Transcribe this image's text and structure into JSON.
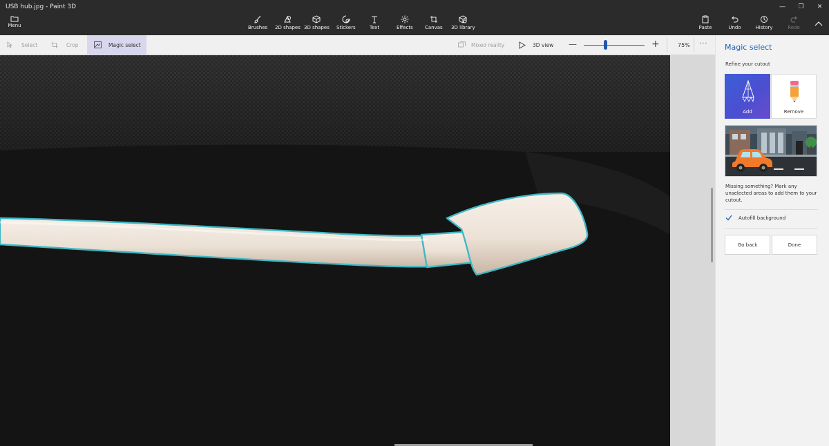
{
  "app": {
    "title": "USB hub.jpg - Paint 3D"
  },
  "window_controls": {
    "minimize": "—",
    "restore": "❐",
    "close": "✕"
  },
  "ribbon": {
    "menu_label": "Menu",
    "tools": [
      {
        "label": "Brushes",
        "icon": "brush-icon"
      },
      {
        "label": "2D shapes",
        "icon": "2d-shapes-icon"
      },
      {
        "label": "3D shapes",
        "icon": "3d-shapes-icon"
      },
      {
        "label": "Stickers",
        "icon": "stickers-icon"
      },
      {
        "label": "Text",
        "icon": "text-icon"
      },
      {
        "label": "Effects",
        "icon": "effects-icon"
      },
      {
        "label": "Canvas",
        "icon": "canvas-icon"
      },
      {
        "label": "3D library",
        "icon": "3d-library-icon"
      }
    ],
    "right_tools": [
      {
        "label": "Paste",
        "icon": "paste-icon",
        "enabled": true
      },
      {
        "label": "Undo",
        "icon": "undo-icon",
        "enabled": true
      },
      {
        "label": "History",
        "icon": "history-icon",
        "enabled": true
      },
      {
        "label": "Redo",
        "icon": "redo-icon",
        "enabled": false
      }
    ]
  },
  "subbar": {
    "select_label": "Select",
    "crop_label": "Crop",
    "magic_select_label": "Magic select",
    "mixed_reality_label": "Mixed reality",
    "view3d_label": "3D view",
    "zoom_minus": "—",
    "zoom_plus": "+",
    "zoom_value": "75%",
    "zoom_slider_fraction": 0.33,
    "more_label": "···"
  },
  "panel": {
    "title": "Magic select",
    "subtitle": "Refine your cutout",
    "add_label": "Add",
    "remove_label": "Remove",
    "hint": "Missing something? Mark any unselected areas to add them to your cutout.",
    "autofill_label": "Autofill background",
    "autofill_checked": true,
    "go_back_label": "Go back",
    "done_label": "Done"
  },
  "colors": {
    "accent": "#1a5fb4",
    "ribbon_bg": "#2b2b2b",
    "selection_outline": "#3fb8c4"
  }
}
